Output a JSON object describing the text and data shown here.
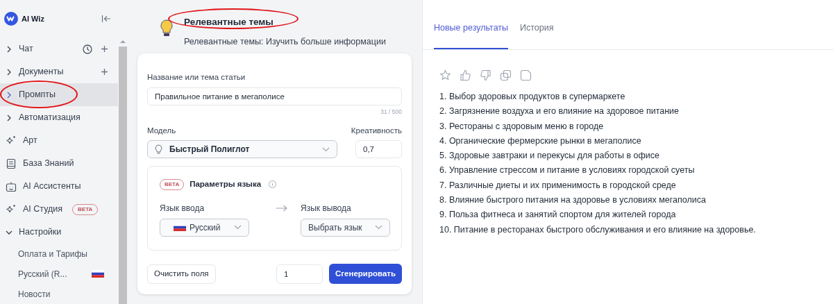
{
  "app": {
    "name": "AI Wiz"
  },
  "sidebar": {
    "items": [
      {
        "kind": "expandable",
        "label": "Чат",
        "expanded": false,
        "selected": false,
        "circled": false
      },
      {
        "kind": "expandable",
        "label": "Документы",
        "expanded": false,
        "selected": false,
        "circled": false
      },
      {
        "kind": "expandable",
        "label": "Промпты",
        "expanded": false,
        "selected": true,
        "circled": true
      },
      {
        "kind": "expandable",
        "label": "Автоматизация",
        "expanded": false,
        "selected": false,
        "circled": false
      },
      {
        "kind": "link",
        "label": "Арт",
        "selected": false,
        "circled": false
      },
      {
        "kind": "link",
        "label": "База Знаний",
        "selected": false,
        "circled": false
      },
      {
        "kind": "link",
        "label": "AI Ассистенты",
        "selected": false,
        "circled": false
      },
      {
        "kind": "link",
        "label": "AI Студия",
        "badge": "BETA",
        "selected": false,
        "circled": false
      },
      {
        "kind": "expandable",
        "label": "Настройки",
        "expanded": true,
        "selected": false,
        "circled": false,
        "children": [
          {
            "label": "Оплата и Тарифы",
            "selected": false
          },
          {
            "label": "Русский (R...",
            "selected": false
          },
          {
            "label": "Новости",
            "selected": false
          }
        ]
      }
    ]
  },
  "tool": {
    "title": "Релевантные темы",
    "title_circled": true,
    "subtitle": "Релевантные темы: Изучить больше информации"
  },
  "form": {
    "topic_label": "Название или тема статьи",
    "topic_value": "Правильное питание в мегаполисе",
    "counter": "31 / 500",
    "model_label": "Модель",
    "model_value": "Быстрый Полиглот",
    "creativity_label": "Креативность",
    "creativity_value": "0,7",
    "language": {
      "badge": "BETA",
      "title": "Параметры языка",
      "input_label": "Язык ввода",
      "input_value": "Русский",
      "output_label": "Язык вывода",
      "output_placeholder": "Выбрать язык"
    },
    "clear_button": "Очистить поля",
    "count_value": "1",
    "generate_button": "Сгенерировать"
  },
  "results": {
    "tabs": [
      {
        "label": "Новые результаты",
        "selected": true
      },
      {
        "label": "История",
        "selected": false
      }
    ],
    "items": [
      "1. Выбор здоровых продуктов в супермаркете",
      "2. Загрязнение воздуха и его влияние на здоровое питание",
      "3. Рестораны с здоровым меню в городе",
      "4. Органические фермерские рынки в мегаполисе",
      "5. Здоровые завтраки и перекусы для работы в офисе",
      "6. Управление стрессом и питание в условиях городской суеты",
      "7. Различные диеты и их применимость в городской среде",
      "8. Влияние быстрого питания на здоровье в условиях мегаполиса",
      "9. Польза фитнеса и занятий спортом для жителей города",
      "10. Питание в ресторанах быстрого обслуживания и его влияние на здоровье."
    ]
  }
}
